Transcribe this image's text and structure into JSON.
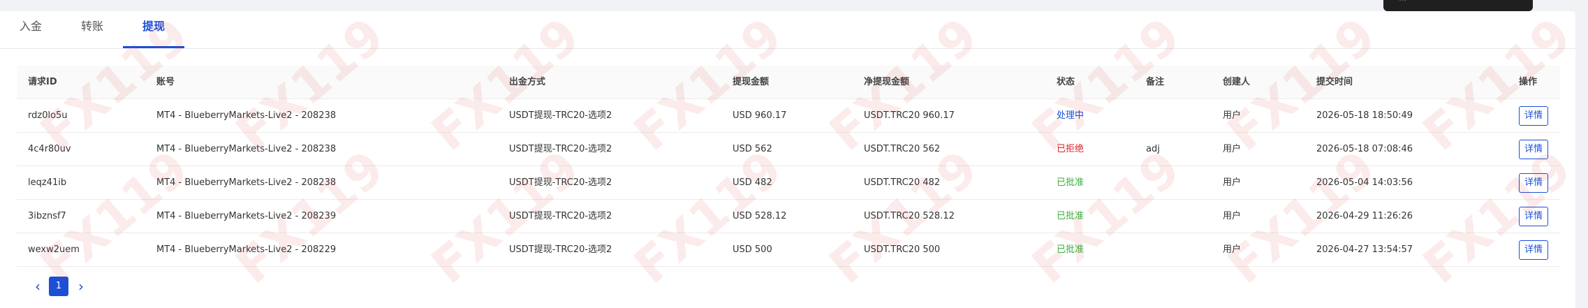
{
  "tabs": [
    "入金",
    "转账",
    "提现"
  ],
  "active_tab": 2,
  "table": {
    "headers": [
      "请求ID",
      "账号",
      "出金方式",
      "提现金额",
      "净提现金额",
      "状态",
      "备注",
      "创建人",
      "提交时间",
      "操作"
    ],
    "rows": [
      {
        "id": "rdz0lo5u",
        "account": "MT4 - BlueberryMarkets-Live2 - 208238",
        "method": "USDT提现-TRC20-选项2",
        "amount": "USD 960.17",
        "net": "USDT.TRC20 960.17",
        "status": "处理中",
        "status_type": "processing",
        "note": "",
        "creator": "用户",
        "time": "2026-05-18 18:50:49",
        "action": "详情"
      },
      {
        "id": "4c4r80uv",
        "account": "MT4 - BlueberryMarkets-Live2 - 208238",
        "method": "USDT提现-TRC20-选项2",
        "amount": "USD 562",
        "net": "USDT.TRC20 562",
        "status": "已拒绝",
        "status_type": "rejected",
        "note": "adj",
        "creator": "用户",
        "time": "2026-05-18 07:08:46",
        "action": "详情"
      },
      {
        "id": "leqz41ib",
        "account": "MT4 - BlueberryMarkets-Live2 - 208238",
        "method": "USDT提现-TRC20-选项2",
        "amount": "USD 482",
        "net": "USDT.TRC20 482",
        "status": "已批准",
        "status_type": "approved",
        "note": "",
        "creator": "用户",
        "time": "2026-05-04 14:03:56",
        "action": "详情"
      },
      {
        "id": "3ibznsf7",
        "account": "MT4 - BlueberryMarkets-Live2 - 208239",
        "method": "USDT提现-TRC20-选项2",
        "amount": "USD 528.12",
        "net": "USDT.TRC20 528.12",
        "status": "已批准",
        "status_type": "approved",
        "note": "",
        "creator": "用户",
        "time": "2026-04-29 11:26:26",
        "action": "详情"
      },
      {
        "id": "wexw2uem",
        "account": "MT4 - BlueberryMarkets-Live2 - 208229",
        "method": "USDT提现-TRC20-选项2",
        "amount": "USD 500",
        "net": "USDT.TRC20 500",
        "status": "已批准",
        "status_type": "approved",
        "note": "",
        "creator": "用户",
        "time": "2026-04-27 13:54:57",
        "action": "详情"
      }
    ]
  },
  "pagination": {
    "current_page": "1",
    "prev_icon": "chevron-left-icon",
    "next_icon": "chevron-right-icon"
  },
  "watermark": "FX119",
  "colors": {
    "accent": "#1b4fd8",
    "processing": "#1b4fd8",
    "rejected": "#e02020",
    "approved": "#3bae3b"
  }
}
